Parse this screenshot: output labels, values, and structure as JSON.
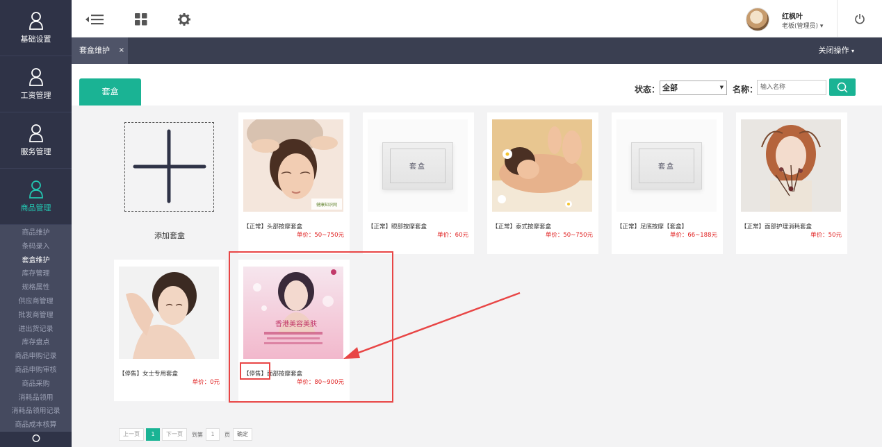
{
  "sidebar": {
    "main_items": [
      {
        "label": "基础设置",
        "icon": "user-icon"
      },
      {
        "label": "工资管理",
        "icon": "user-icon"
      },
      {
        "label": "服务管理",
        "icon": "user-icon"
      },
      {
        "label": "商品管理",
        "icon": "user-icon"
      }
    ],
    "sub_items": [
      "商品维护",
      "条码录入",
      "套盒维护",
      "库存管理",
      "规格属性",
      "供应商管理",
      "批发商管理",
      "进出货记录",
      "库存盘点",
      "商品申购记录",
      "商品申购审核",
      "商品采购",
      "消耗品领用",
      "消耗品领用记录",
      "商品成本核算"
    ],
    "active_sub": "套盒维护"
  },
  "topbar": {
    "user_name": "红枫叶",
    "user_role": "老板(管理员)",
    "role_caret": "▾"
  },
  "tabbar": {
    "tab_label": "套盒维护",
    "tab_close": "×",
    "close_ops": "关闭操作"
  },
  "panel": {
    "tab": "套盒",
    "status_label": "状态：",
    "status_value": "全部",
    "name_label": "名称：",
    "name_placeholder": "输入名称"
  },
  "add_card": {
    "label": "添加套盒"
  },
  "products": [
    {
      "title": "【正常】头部按摩套盒",
      "price": "单价：50~750元",
      "image": "head-massage"
    },
    {
      "title": "【正常】眼部按摩套盒",
      "price": "单价：60元",
      "image": "box"
    },
    {
      "title": "【正常】泰式按摩套盒",
      "price": "单价：50~750元",
      "image": "thai-massage"
    },
    {
      "title": "【正常】足底按摩【套盒】",
      "price": "单价：66~188元",
      "image": "box"
    },
    {
      "title": "【正常】面部护理消耗套盒",
      "price": "单价：50元",
      "image": "portrait"
    },
    {
      "title": "【停售】女士专用套盒",
      "price": "单价：0元",
      "image": "woman"
    },
    {
      "title": "【停售】面部按摩套盒",
      "price": "单价：80~900元",
      "image": "poster"
    }
  ],
  "box_text": "套盒",
  "watermark": "健康知识网",
  "poster_text": "香港美容美肤",
  "pagination": {
    "prev": "上一页",
    "current": "1",
    "next": "下一页",
    "goto": "到第",
    "page_input": "1",
    "page_unit": "页",
    "confirm": "确定"
  },
  "colors": {
    "accent": "#1ab394",
    "sidebar": "#2f3347",
    "price": "#e02020",
    "annotation": "#e84545"
  }
}
